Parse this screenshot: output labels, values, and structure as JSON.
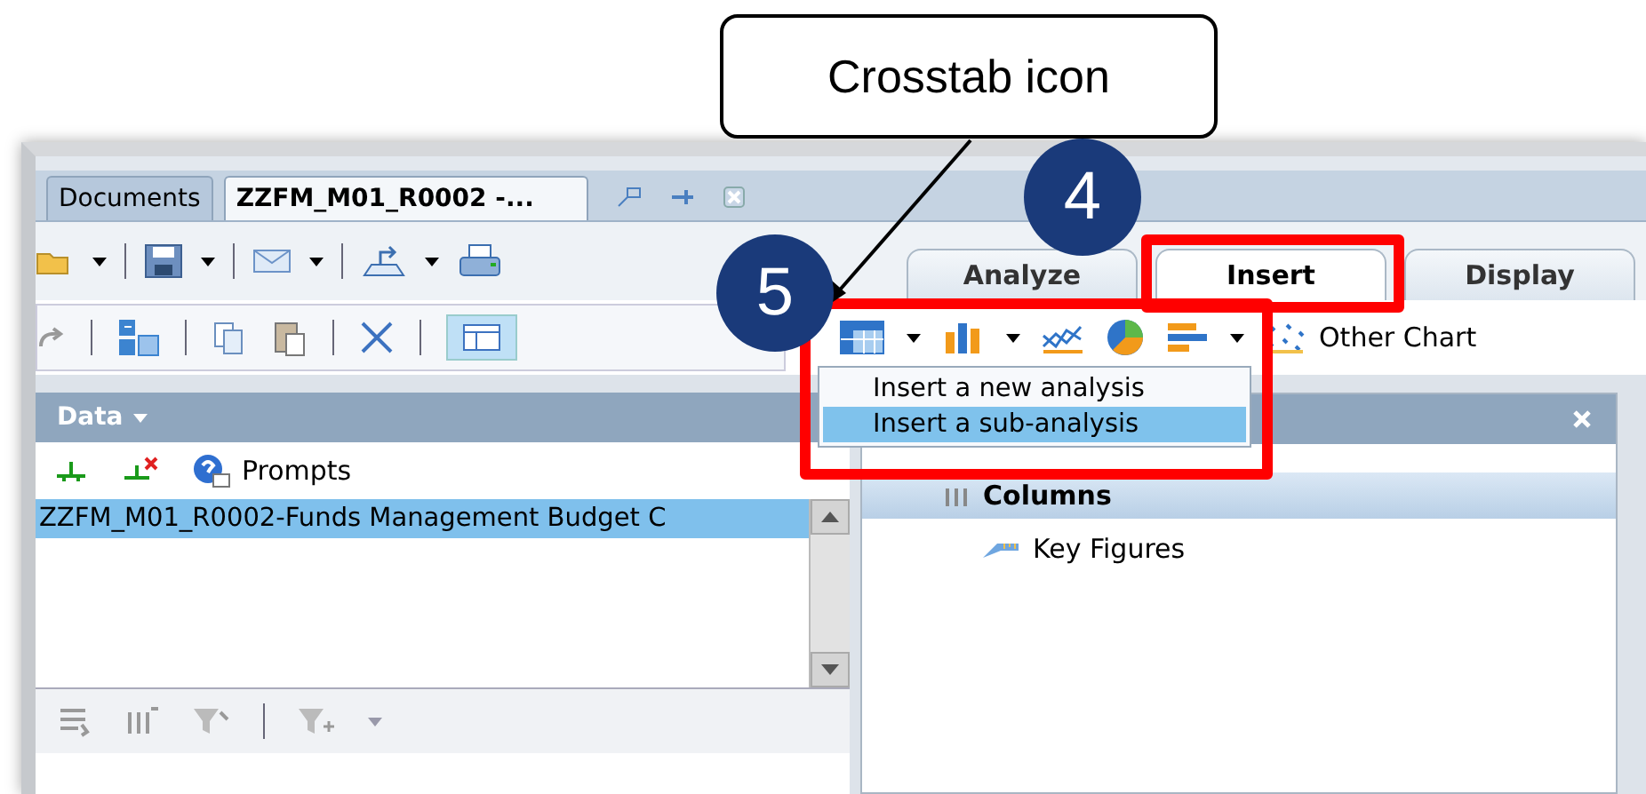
{
  "callout": {
    "text": "Crosstab icon"
  },
  "steps": [
    {
      "number": "5"
    },
    {
      "number": "4"
    }
  ],
  "document_tabs": [
    {
      "label": "Documents",
      "selected": false
    },
    {
      "label": "ZZFM_M01_R0002 -...",
      "selected": true
    }
  ],
  "ribbon_tabs": [
    {
      "label": "Analyze",
      "selected": false
    },
    {
      "label": "Insert",
      "selected": true
    },
    {
      "label": "Display",
      "selected": false
    }
  ],
  "ribbon_tools": {
    "other_chart": "Other Chart"
  },
  "insert_menu": [
    {
      "label": "Insert a new analysis",
      "selected": false
    },
    {
      "label": "Insert a sub-analysis",
      "selected": true
    }
  ],
  "data_panel": {
    "title": "Data",
    "prompts": "Prompts",
    "items": [
      {
        "label": "ZZFM_M01_R0002-Funds Management Budget C",
        "selected": true
      }
    ]
  },
  "layout_panel": {
    "sections": [
      {
        "label": "Columns",
        "children": [
          {
            "label": "Key Figures"
          }
        ]
      }
    ]
  }
}
